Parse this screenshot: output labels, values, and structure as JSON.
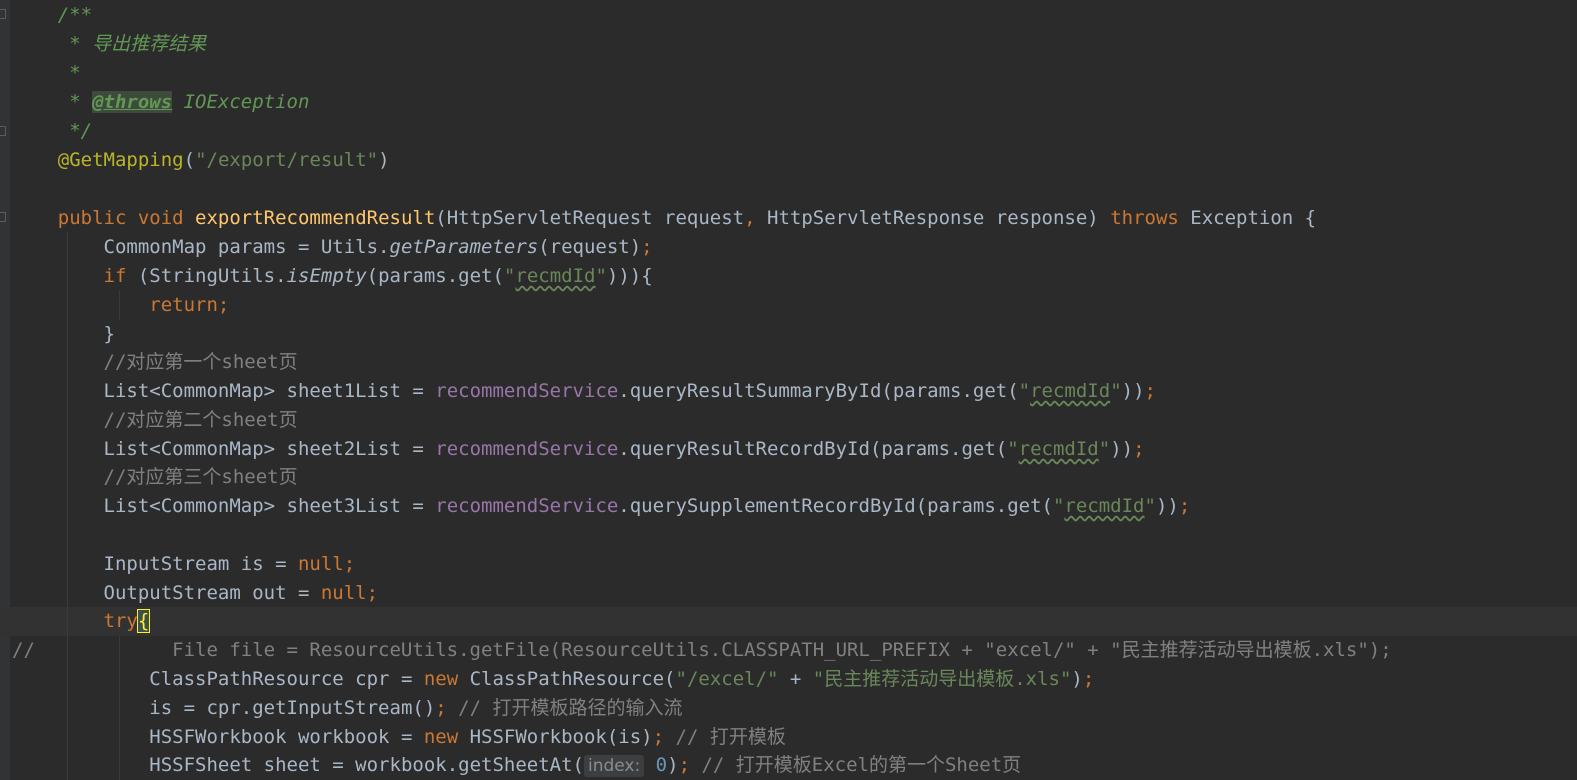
{
  "editor": {
    "colors": {
      "background": "#2b2b2b",
      "keyword": "#cc7832",
      "string": "#6a8759",
      "comment": "#808080",
      "javadoc": "#629755",
      "annotation": "#bbb529",
      "method_decl": "#ffc66d",
      "field": "#9876aa",
      "text": "#a9b7c6"
    },
    "code": {
      "l1": "/**",
      "l2": " * 导出推荐结果",
      "l3": " *",
      "l4_star": " * ",
      "l4_tag": "@throws",
      "l4_rest": " IOException",
      "l5": " */",
      "l6_ann": "@GetMapping",
      "l6_open": "(",
      "l6_str": "\"/export/result\"",
      "l6_close": ")",
      "l8_public": "public",
      "l8_void": " void ",
      "l8_name": "exportRecommendResult",
      "l8_params": "(HttpServletRequest request",
      "l8_comma": ",",
      "l8_params2": " HttpServletResponse response) ",
      "l8_throws": "throws",
      "l8_exc": " Exception {",
      "l9_a": "CommonMap params = Utils.",
      "l9_m": "getParameters",
      "l9_b": "(request)",
      "l9_semi": ";",
      "l10_if": "if",
      "l10_a": " (StringUtils.",
      "l10_m": "isEmpty",
      "l10_b": "(params.get(",
      "l10_q1": "\"",
      "l10_s": "recmdId",
      "l10_q2": "\"",
      "l10_c": "))){",
      "l11_ret": "return;",
      "l12": "}",
      "l13": "//对应第一个sheet页",
      "l14_a": "List<CommonMap> sheet1List = ",
      "l14_f": "recommendService",
      "l14_b": ".queryResultSummaryById(params.get(",
      "l14_q1": "\"",
      "l14_s": "recmdId",
      "l14_q2": "\"",
      "l14_c": "))",
      "l14_semi": ";",
      "l15": "//对应第二个sheet页",
      "l16_a": "List<CommonMap> sheet2List = ",
      "l16_f": "recommendService",
      "l16_b": ".queryResultRecordById(params.get(",
      "l16_q1": "\"",
      "l16_s": "recmdId",
      "l16_q2": "\"",
      "l16_c": "))",
      "l16_semi": ";",
      "l17": "//对应第三个sheet页",
      "l18_a": "List<CommonMap> sheet3List = ",
      "l18_f": "recommendService",
      "l18_b": ".querySupplementRecordById(params.get(",
      "l18_q1": "\"",
      "l18_s": "recmdId",
      "l18_q2": "\"",
      "l18_c": "))",
      "l18_semi": ";",
      "l20_a": "InputStream is = ",
      "l20_null": "null;",
      "l21_a": "OutputStream out = ",
      "l21_null": "null;",
      "l22_try": "try",
      "l22_brace": "{",
      "l23": "//            File file = ResourceUtils.getFile(ResourceUtils.CLASSPATH_URL_PREFIX + \"excel/\" + \"民主推荐活动导出模板.xls\");",
      "l24_a": "ClassPathResource cpr = ",
      "l24_new": "new",
      "l24_b": " ClassPathResource(",
      "l24_s1": "\"/excel/\"",
      "l24_plus": " + ",
      "l24_s2": "\"民主推荐活动导出模板.xls\"",
      "l24_c": ")",
      "l24_semi": ";",
      "l25_a": "is = cpr.getInputStream()",
      "l25_semi": ";",
      "l25_cmt": " // 打开模板路径的输入流",
      "l26_a": "HSSFWorkbook workbook = ",
      "l26_new": "new",
      "l26_b": " HSSFWorkbook(is)",
      "l26_semi": ";",
      "l26_cmt": " // 打开模板",
      "l27_a": "HSSFSheet sheet = workbook.getSheetAt(",
      "l27_hint": "index:",
      "l27_num": " 0",
      "l27_b": ")",
      "l27_semi": ";",
      "l27_cmt": " // 打开模板Excel的第一个Sheet页"
    }
  }
}
